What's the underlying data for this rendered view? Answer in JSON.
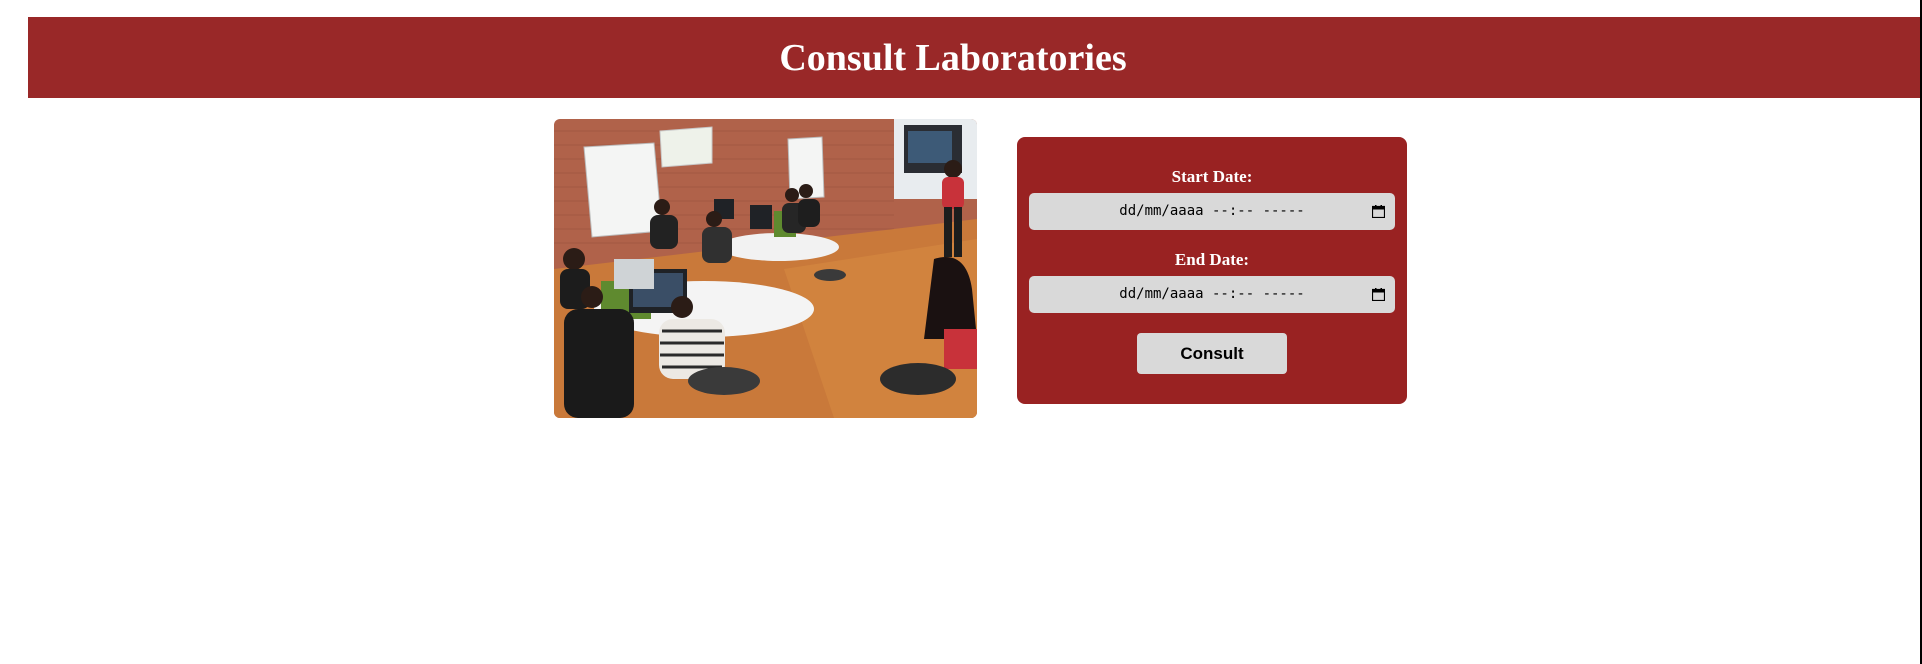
{
  "header": {
    "title": "Consult Laboratories"
  },
  "photo": {
    "alt": "Computer laboratory with students working"
  },
  "form": {
    "start_label": "Start Date:",
    "start_value": "dd/mm/aaaa --:-- -----",
    "end_label": "End Date:",
    "end_value": "dd/mm/aaaa --:-- -----",
    "submit_label": "Consult"
  },
  "colors": {
    "header_bg": "#992828",
    "card_bg": "#992222",
    "input_bg": "#d9d9d9",
    "text_light": "#ffffff"
  },
  "icons": {
    "date_picker": "calendar-icon"
  }
}
